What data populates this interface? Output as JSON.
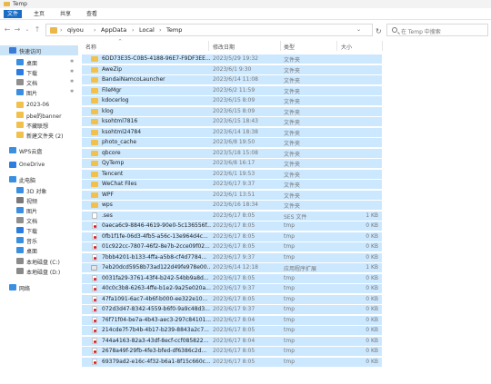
{
  "window": {
    "title": "Temp"
  },
  "ribbon": {
    "tabs": [
      "文件",
      "主页",
      "共享",
      "查看"
    ]
  },
  "address": {
    "segments": [
      "qiyou",
      "AppData",
      "Local",
      "Temp"
    ],
    "search_placeholder": "在 Temp 中搜索"
  },
  "nav": {
    "back": "←",
    "forward": "→",
    "history": "⌄",
    "up": "↑",
    "refresh": "↻",
    "path_chevron": "›",
    "dropdown": "⌄"
  },
  "sidebar": {
    "items": [
      {
        "label": "快速访问",
        "icon": "star-icon",
        "color": "#3a7bd5",
        "indent": 0,
        "pinned": false
      },
      {
        "label": "桌面",
        "icon": "desktop-icon",
        "color": "#3a8fe0",
        "indent": 1,
        "pinned": true
      },
      {
        "label": "下载",
        "icon": "download-icon",
        "color": "#2b7de0",
        "indent": 1,
        "pinned": true
      },
      {
        "label": "文档",
        "icon": "documents-icon",
        "color": "#8f8f8f",
        "indent": 1,
        "pinned": true
      },
      {
        "label": "图片",
        "icon": "pictures-icon",
        "color": "#3a8fe0",
        "indent": 1,
        "pinned": true
      },
      {
        "label": "2023-06",
        "icon": "folder-icon",
        "color": "#f1c14b",
        "indent": 1,
        "pinned": false
      },
      {
        "label": "pbe的banner",
        "icon": "folder-icon",
        "color": "#f1c14b",
        "indent": 1,
        "pinned": false
      },
      {
        "label": "不藏联想",
        "icon": "folder-icon",
        "color": "#f1c14b",
        "indent": 1,
        "pinned": false
      },
      {
        "label": "新建文件夹 (2)",
        "icon": "folder-icon",
        "color": "#f1c14b",
        "indent": 1,
        "pinned": false
      },
      {
        "label": "WPS云盘",
        "icon": "cloud-icon",
        "color": "#3a8fe0",
        "indent": 0,
        "pinned": false
      },
      {
        "label": "OneDrive",
        "icon": "onedrive-icon",
        "color": "#2b7de0",
        "indent": 0,
        "pinned": false
      },
      {
        "label": "此电脑",
        "icon": "computer-icon",
        "color": "#3a8fe0",
        "indent": 0,
        "pinned": false
      },
      {
        "label": "3D 对象",
        "icon": "3d-objects-icon",
        "color": "#3a8fe0",
        "indent": 1,
        "pinned": false
      },
      {
        "label": "视频",
        "icon": "videos-icon",
        "color": "#7a7a7a",
        "indent": 1,
        "pinned": false
      },
      {
        "label": "图片",
        "icon": "pictures-icon",
        "color": "#3a8fe0",
        "indent": 1,
        "pinned": false
      },
      {
        "label": "文档",
        "icon": "documents-icon",
        "color": "#8f8f8f",
        "indent": 1,
        "pinned": false
      },
      {
        "label": "下载",
        "icon": "download-icon",
        "color": "#2b7de0",
        "indent": 1,
        "pinned": false
      },
      {
        "label": "音乐",
        "icon": "music-icon",
        "color": "#3a8fe0",
        "indent": 1,
        "pinned": false
      },
      {
        "label": "桌面",
        "icon": "desktop-icon",
        "color": "#3a8fe0",
        "indent": 1,
        "pinned": false
      },
      {
        "label": "本地磁盘 (C:)",
        "icon": "drive-icon",
        "color": "#8a8a8a",
        "indent": 1,
        "pinned": false
      },
      {
        "label": "本地磁盘 (D:)",
        "icon": "drive-icon",
        "color": "#8a8a8a",
        "indent": 1,
        "pinned": false
      },
      {
        "label": "网络",
        "icon": "network-icon",
        "color": "#3a8fe0",
        "indent": 0,
        "pinned": false
      }
    ]
  },
  "columns": {
    "name": "名称",
    "date": "修改日期",
    "type": "类型",
    "size": "大小"
  },
  "files": [
    {
      "name": "6DD73E35-C0B5-4188-96E7-F9DF3EE...",
      "date": "2023/5/29 19:32",
      "type": "文件夹",
      "size": "",
      "icon": "folder"
    },
    {
      "name": "AweZip",
      "date": "2023/6/1 9:30",
      "type": "文件夹",
      "size": "",
      "icon": "folder"
    },
    {
      "name": "BandaiNamcoLauncher",
      "date": "2023/6/14 11:08",
      "type": "文件夹",
      "size": "",
      "icon": "folder"
    },
    {
      "name": "FileMgr",
      "date": "2023/6/2 11:59",
      "type": "文件夹",
      "size": "",
      "icon": "folder"
    },
    {
      "name": "kdocerlog",
      "date": "2023/6/15 8:09",
      "type": "文件夹",
      "size": "",
      "icon": "folder"
    },
    {
      "name": "klog",
      "date": "2023/6/15 8:09",
      "type": "文件夹",
      "size": "",
      "icon": "folder"
    },
    {
      "name": "ksohtml7816",
      "date": "2023/6/15 18:43",
      "type": "文件夹",
      "size": "",
      "icon": "folder"
    },
    {
      "name": "ksohtml24784",
      "date": "2023/6/14 18:38",
      "type": "文件夹",
      "size": "",
      "icon": "folder"
    },
    {
      "name": "photo_cache",
      "date": "2023/6/8 19:50",
      "type": "文件夹",
      "size": "",
      "icon": "folder"
    },
    {
      "name": "qbcore",
      "date": "2023/5/18 15:08",
      "type": "文件夹",
      "size": "",
      "icon": "folder"
    },
    {
      "name": "QyTemp",
      "date": "2023/6/8 16:17",
      "type": "文件夹",
      "size": "",
      "icon": "folder"
    },
    {
      "name": "Tencent",
      "date": "2023/6/1 19:53",
      "type": "文件夹",
      "size": "",
      "icon": "folder"
    },
    {
      "name": "WeChat Files",
      "date": "2023/6/17 9:37",
      "type": "文件夹",
      "size": "",
      "icon": "folder"
    },
    {
      "name": "WPF",
      "date": "2023/6/1 13:51",
      "type": "文件夹",
      "size": "",
      "icon": "folder"
    },
    {
      "name": "wps",
      "date": "2023/6/16 18:34",
      "type": "文件夹",
      "size": "",
      "icon": "folder"
    },
    {
      "name": ".ses",
      "date": "2023/6/17 8:05",
      "type": "SES 文件",
      "size": "1 KB",
      "icon": "file"
    },
    {
      "name": "0aeca6c9-8846-4619-90e0-5c136556f...",
      "date": "2023/6/17 8:05",
      "type": "tmp",
      "size": "0 KB",
      "icon": "tmp"
    },
    {
      "name": "0fb1f1fe-06d3-4fb5-a56c-13e964d4c...",
      "date": "2023/6/17 8:05",
      "type": "tmp",
      "size": "0 KB",
      "icon": "tmp"
    },
    {
      "name": "01c922cc-7807-46f2-8e7b-2cce09f02...",
      "date": "2023/6/17 8:05",
      "type": "tmp",
      "size": "0 KB",
      "icon": "tmp"
    },
    {
      "name": "7bbb4201-b133-4ffa-a5b8-cf4d7784...",
      "date": "2023/6/17 9:37",
      "type": "tmp",
      "size": "0 KB",
      "icon": "tmp"
    },
    {
      "name": "7eb20dcd5958b73ad122d49fe978e00...",
      "date": "2023/6/14 12:18",
      "type": "应用程序扩展",
      "size": "1 KB",
      "icon": "app"
    },
    {
      "name": "0031fa29-3761-43f4-b242-54bb9a8d...",
      "date": "2023/6/17 8:05",
      "type": "tmp",
      "size": "0 KB",
      "icon": "tmp"
    },
    {
      "name": "40c0c3b8-6263-4ffe-b1e2-9a25e020a...",
      "date": "2023/6/17 9:37",
      "type": "tmp",
      "size": "0 KB",
      "icon": "tmp"
    },
    {
      "name": "47fa1091-6ac7-4b6f-b000-ee322e10...",
      "date": "2023/6/17 8:05",
      "type": "tmp",
      "size": "0 KB",
      "icon": "tmp"
    },
    {
      "name": "072d3d47-8342-4559-b6f0-9a9c48d3...",
      "date": "2023/6/17 9:37",
      "type": "tmp",
      "size": "0 KB",
      "icon": "tmp"
    },
    {
      "name": "76f71f04-be7a-4b43-aec3-297c84101...",
      "date": "2023/6/17 8:04",
      "type": "tmp",
      "size": "0 KB",
      "icon": "tmp"
    },
    {
      "name": "214cde7f-7b4b-4b17-b239-8843a2c7...",
      "date": "2023/6/17 8:05",
      "type": "tmp",
      "size": "0 KB",
      "icon": "tmp"
    },
    {
      "name": "744a4163-82a3-43df-8ecf-ccf085822...",
      "date": "2023/6/17 8:04",
      "type": "tmp",
      "size": "0 KB",
      "icon": "tmp"
    },
    {
      "name": "2678a49f-29fb-4fe3-bfed-df6386c2d...",
      "date": "2023/6/17 8:05",
      "type": "tmp",
      "size": "0 KB",
      "icon": "tmp"
    },
    {
      "name": "69379ad2-e16c-4f32-b6a1-8f15c660c...",
      "date": "2023/6/17 8:05",
      "type": "tmp",
      "size": "0 KB",
      "icon": "tmp"
    }
  ]
}
